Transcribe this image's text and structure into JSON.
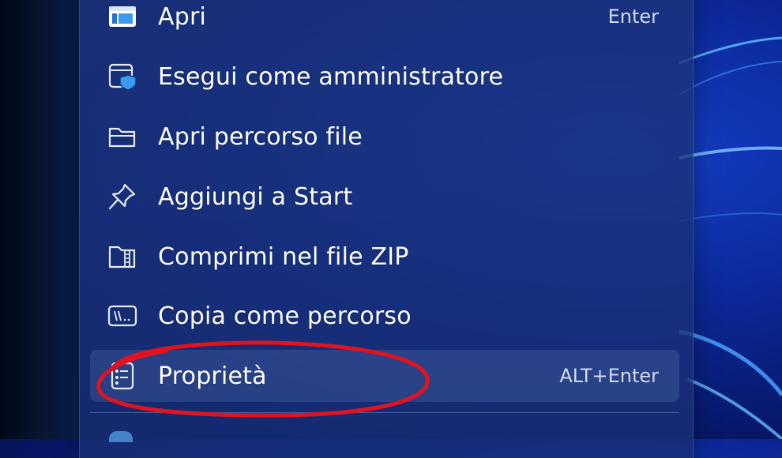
{
  "context_menu": {
    "items": [
      {
        "label": "Apri",
        "shortcut": "Enter",
        "icon": "app-window-icon"
      },
      {
        "label": "Esegui come amministratore",
        "shortcut": "",
        "icon": "shield-window-icon"
      },
      {
        "label": "Apri percorso file",
        "shortcut": "",
        "icon": "folder-icon"
      },
      {
        "label": "Aggiungi a Start",
        "shortcut": "",
        "icon": "pin-icon"
      },
      {
        "label": "Comprimi nel file ZIP",
        "shortcut": "",
        "icon": "zip-folder-icon"
      },
      {
        "label": "Copia come percorso",
        "shortcut": "",
        "icon": "copy-path-icon"
      },
      {
        "label": "Proprietà",
        "shortcut": "ALT+Enter",
        "icon": "properties-icon"
      }
    ],
    "selected_index": 6
  },
  "annotation": {
    "shape": "ellipse",
    "color": "#e0141e"
  },
  "colors": {
    "accent": "#4aa3f0",
    "annotation": "#e0141e"
  }
}
